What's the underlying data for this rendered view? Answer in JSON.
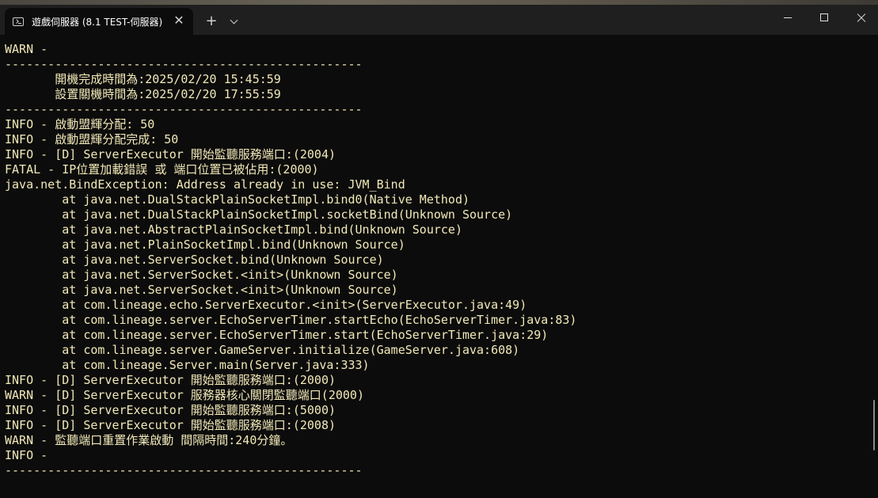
{
  "window": {
    "tab_title": "遊戲伺服器 (8.1 TEST-伺服器)",
    "tab_icon": "terminal-icon",
    "close_tab_glyph": "✕",
    "new_tab_glyph": "+",
    "controls": [
      "minimize",
      "maximize",
      "close"
    ]
  },
  "console": {
    "text_color": "#f2e9b8",
    "background": "#0c0c0c",
    "lines": [
      "WARN -",
      "--------------------------------------------------",
      "       開機完成時間為:2025/02/20 15:45:59",
      "       設置關機時間為:2025/02/20 17:55:59",
      "--------------------------------------------------",
      "INFO - 啟動盟輝分配: 50",
      "INFO - 啟動盟輝分配完成: 50",
      "INFO - [D] ServerExecutor 開始監聽服務端口:(2004)",
      "FATAL - IP位置加載錯誤 或 端口位置已被佔用:(2000)",
      "java.net.BindException: Address already in use: JVM_Bind",
      "        at java.net.DualStackPlainSocketImpl.bind0(Native Method)",
      "        at java.net.DualStackPlainSocketImpl.socketBind(Unknown Source)",
      "        at java.net.AbstractPlainSocketImpl.bind(Unknown Source)",
      "        at java.net.PlainSocketImpl.bind(Unknown Source)",
      "        at java.net.ServerSocket.bind(Unknown Source)",
      "        at java.net.ServerSocket.<init>(Unknown Source)",
      "        at java.net.ServerSocket.<init>(Unknown Source)",
      "        at com.lineage.echo.ServerExecutor.<init>(ServerExecutor.java:49)",
      "        at com.lineage.server.EchoServerTimer.startEcho(EchoServerTimer.java:83)",
      "        at com.lineage.server.EchoServerTimer.start(EchoServerTimer.java:29)",
      "        at com.lineage.server.GameServer.initialize(GameServer.java:608)",
      "        at com.lineage.Server.main(Server.java:333)",
      "INFO - [D] ServerExecutor 開始監聽服務端口:(2000)",
      "WARN - [D] ServerExecutor 服務器核心關閉監聽端口(2000)",
      "INFO - [D] ServerExecutor 開始監聽服務端口:(5000)",
      "INFO - [D] ServerExecutor 開始監聽服務端口:(2008)",
      "WARN - 監聽端口重置作業啟動 間隔時間:240分鐘。",
      "INFO -",
      "--------------------------------------------------"
    ]
  }
}
